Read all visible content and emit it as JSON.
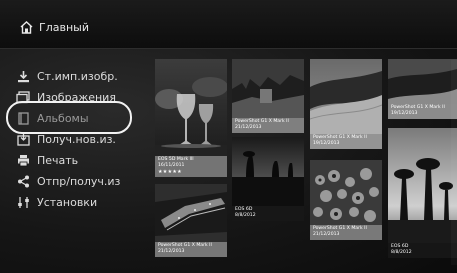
{
  "header": {
    "title": "Главный",
    "icon": "home-icon"
  },
  "menu": {
    "items": [
      {
        "label": "Ст.имп.изобр.",
        "icon": "import-icon"
      },
      {
        "label": "Изображения",
        "icon": "images-icon"
      },
      {
        "label": "Альбомы",
        "icon": "album-icon",
        "selected": true
      },
      {
        "label": "Получ.нов.из.",
        "icon": "receive-icon"
      },
      {
        "label": "Печать",
        "icon": "print-icon"
      },
      {
        "label": "Отпр/получ.из",
        "icon": "share-icon"
      },
      {
        "label": "Установки",
        "icon": "settings-icon"
      }
    ]
  },
  "albums": [
    {
      "model": "EOS 5D Mark III",
      "date": "16/11/2011",
      "rating": "★★★★★"
    },
    {
      "model": "PowerShot G1 X Mark II",
      "date": "21/12/2013"
    },
    {
      "model": "PowerShot G1 X Mark II",
      "date": "21/12/2013"
    },
    {
      "model": "EOS 6D",
      "date": "8/8/2012"
    },
    {
      "model": "PowerShot G1 X Mark II",
      "date": "19/12/2013"
    },
    {
      "model": "PowerShot G1 X Mark II",
      "date": "21/12/2013"
    },
    {
      "model": "PowerShot G1 X Mark II",
      "date": "19/12/2013"
    },
    {
      "model": "EOS 6D",
      "date": "8/8/2012"
    }
  ]
}
